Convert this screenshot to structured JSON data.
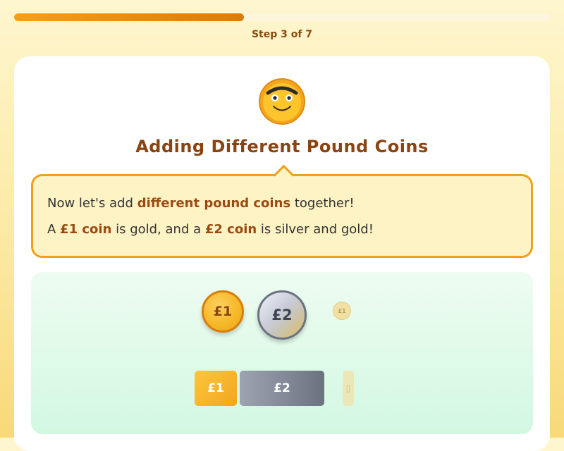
{
  "progress": {
    "current_step": 3,
    "total_steps": 7,
    "fraction": 0.4286,
    "label": "Step 3 of 7"
  },
  "lesson": {
    "mascot_icon": "smiling-sun-icon",
    "title": "Adding Different Pound Coins",
    "speech": {
      "line1_pre": "Now let's add ",
      "line1_highlight": "different pound coins",
      "line1_post": " together!",
      "line2_part1": "A ",
      "line2_highlight1": "£1 coin",
      "line2_part2": " is gold, and a ",
      "line2_highlight2": "£2 coin",
      "line2_part3": " is silver and gold!"
    }
  },
  "coins": [
    {
      "label": "£1",
      "value": 1
    },
    {
      "label": "£2",
      "value": 2
    },
    {
      "label": "£1",
      "value": 1,
      "state": "ghost"
    }
  ],
  "bars": [
    {
      "label": "£1",
      "value": 1
    },
    {
      "label": "£2",
      "value": 2
    },
    {
      "label": "▯",
      "state": "ghost"
    }
  ],
  "colors": {
    "accent": "#f0a11c",
    "title": "#8a4312",
    "gold": "#f5b726",
    "silver": "#6b7280"
  }
}
